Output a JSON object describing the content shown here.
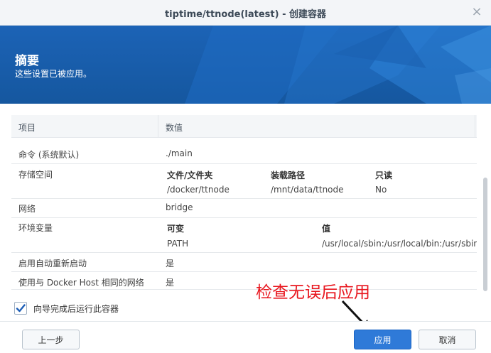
{
  "window": {
    "title": "tiptime/ttnode(latest) - 创建容器",
    "close_icon": "close-icon"
  },
  "banner": {
    "title": "摘要",
    "subtitle": "这些设置已被应用。"
  },
  "table": {
    "headers": {
      "key": "项目",
      "value": "数值"
    },
    "rows": {
      "command": {
        "key": "命令 (系统默认)",
        "value": "./main"
      },
      "storage": {
        "key": "存储空间",
        "headers": [
          "文件/文件夹",
          "装载路径",
          "只读"
        ],
        "values": [
          "/docker/ttnode",
          "/mnt/data/ttnode",
          "No"
        ]
      },
      "network": {
        "key": "网络",
        "value": "bridge"
      },
      "env": {
        "key": "环境变量",
        "headers": [
          "可变",
          "值"
        ],
        "values": [
          "PATH",
          "/usr/local/sbin:/usr/local/bin:/usr/sbin:..."
        ]
      },
      "autorestart": {
        "key": "启用自动重新启动",
        "value": "是"
      },
      "host_network": {
        "key": "使用与 Docker Host 相同的网络",
        "value": "是"
      }
    }
  },
  "run_after_wizard": {
    "label": "向导完成后运行此容器",
    "checked": true
  },
  "annotation": {
    "text": "检查无误后应用",
    "color": "#e8161e"
  },
  "buttons": {
    "prev": "上一步",
    "apply": "应用",
    "cancel": "取消"
  },
  "colors": {
    "banner": "#1c63b6",
    "primary_button": "#2f7ad8"
  }
}
